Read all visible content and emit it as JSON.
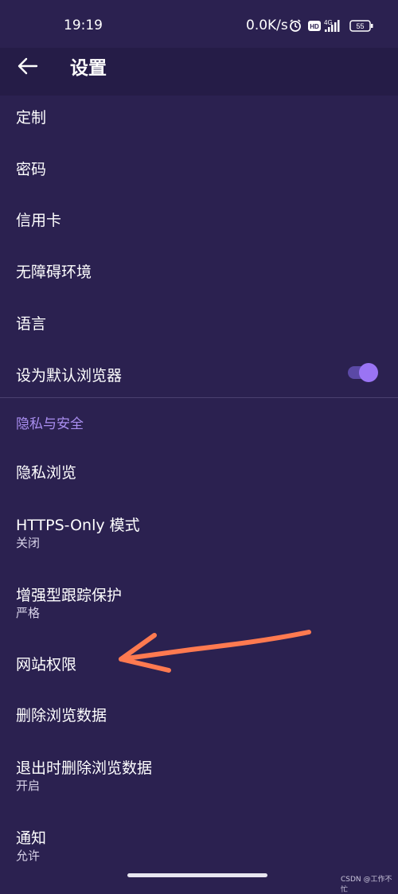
{
  "status": {
    "time": "19:19",
    "netspeed": "0.0K/s",
    "hd": "HD",
    "signal": "4G",
    "battery": "55"
  },
  "appbar": {
    "title": "设置"
  },
  "items": [
    {
      "label": "定制"
    },
    {
      "label": "密码"
    },
    {
      "label": "信用卡"
    },
    {
      "label": "无障碍环境"
    },
    {
      "label": "语言"
    },
    {
      "label": "设为默认浏览器",
      "toggle": true
    },
    {
      "label": "隐私浏览"
    },
    {
      "label": "HTTPS-Only 模式",
      "sub": "关闭"
    },
    {
      "label": "增强型跟踪保护",
      "sub": "严格"
    },
    {
      "label": "网站权限"
    },
    {
      "label": "删除浏览数据"
    },
    {
      "label": "退出时删除浏览数据",
      "sub": "开启"
    },
    {
      "label": "通知",
      "sub": "允许"
    }
  ],
  "section": {
    "label": "隐私与安全"
  },
  "watermark": "CSDN @工作不忙",
  "colors": {
    "background": "#2b2150",
    "accent": "#a98ef0",
    "toggle_on": "#9a74f4",
    "annotation_arrow": "#ff7a50"
  }
}
